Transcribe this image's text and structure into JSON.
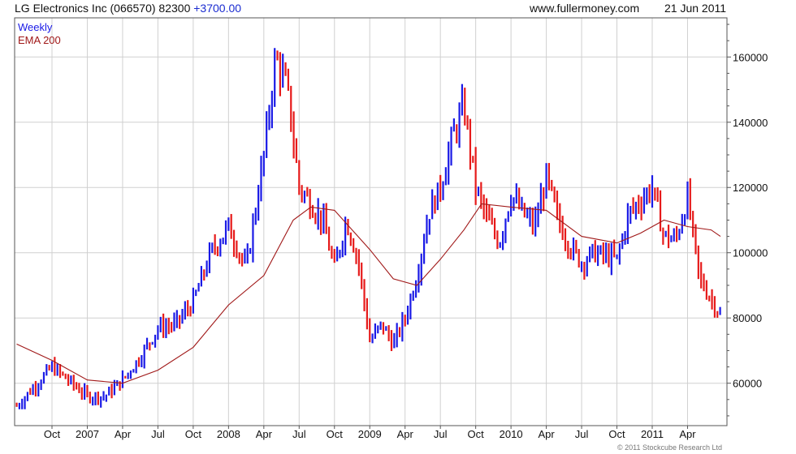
{
  "header": {
    "title": "LG Electronics Inc (066570) 82300",
    "change": "+3700.00",
    "site": "www.fullermoney.com",
    "date": "21 Jun 2011"
  },
  "copyright": "© 2011 Stockcube Research Ltd",
  "colors": {
    "up": "#1a1ae6",
    "down": "#e61a1a",
    "ema": "#a01818",
    "grid": "#d0d0d0",
    "frame": "#555555"
  },
  "chart_data": {
    "type": "line",
    "style": "weekly OHLC bars colored by direction with EMA overlay",
    "ylim": [
      47000,
      172000
    ],
    "yticks": [
      60000,
      80000,
      100000,
      120000,
      140000,
      160000
    ],
    "ytick_labels": [
      "60000",
      "80000",
      "100000",
      "120000",
      "140000",
      "160000"
    ],
    "xrange_months": [
      0,
      57.2
    ],
    "xticks": [
      {
        "label": "Oct",
        "m": 3
      },
      {
        "label": "2007",
        "m": 6
      },
      {
        "label": "Apr",
        "m": 9
      },
      {
        "label": "Jul",
        "m": 12
      },
      {
        "label": "Oct",
        "m": 15
      },
      {
        "label": "2008",
        "m": 18
      },
      {
        "label": "Apr",
        "m": 21
      },
      {
        "label": "Jul",
        "m": 24
      },
      {
        "label": "Oct",
        "m": 27
      },
      {
        "label": "2009",
        "m": 30
      },
      {
        "label": "Apr",
        "m": 33
      },
      {
        "label": "Jul",
        "m": 36
      },
      {
        "label": "Oct",
        "m": 39
      },
      {
        "label": "2010",
        "m": 42
      },
      {
        "label": "Apr",
        "m": 45
      },
      {
        "label": "Jul",
        "m": 48
      },
      {
        "label": "Oct",
        "m": 51
      },
      {
        "label": "2011",
        "m": 54
      },
      {
        "label": "Apr",
        "m": 57
      }
    ],
    "grid": true,
    "legend_position": "top-left",
    "series": [
      {
        "name": "Weekly",
        "x": [
          0,
          3,
          6,
          7.5,
          9,
          10.5,
          12,
          13.5,
          15,
          16.5,
          18,
          19.5,
          21,
          22,
          23,
          24,
          25,
          26,
          27,
          28,
          29,
          30,
          31,
          32,
          33,
          34,
          35,
          36,
          37,
          38,
          39,
          40,
          41,
          42,
          43,
          44,
          45,
          46,
          47,
          48,
          49,
          50,
          51,
          52,
          53,
          54,
          55,
          56,
          57,
          58,
          59.8
        ],
        "y": [
          53000,
          65000,
          56000,
          56000,
          61000,
          68000,
          77000,
          78000,
          85000,
          100000,
          108000,
          95000,
          130000,
          160000,
          150000,
          120000,
          115000,
          110000,
          95000,
          110000,
          98000,
          73000,
          78000,
          72000,
          80000,
          93000,
          112000,
          120000,
          135000,
          145000,
          120000,
          110000,
          103000,
          118000,
          112000,
          108000,
          123000,
          110000,
          102000,
          97000,
          100000,
          99000,
          98000,
          112000,
          116000,
          120000,
          105000,
          104000,
          117000,
          92000,
          81000
        ]
      },
      {
        "name": "EMA 200",
        "x": [
          0,
          3,
          6,
          9,
          12,
          15,
          18,
          21,
          23.5,
          25,
          27,
          30,
          32,
          34,
          36,
          38,
          39.5,
          42,
          45,
          48,
          51,
          53,
          55,
          56,
          57,
          59,
          59.8
        ],
        "y": [
          72000,
          67000,
          61000,
          60000,
          64000,
          71000,
          84000,
          93000,
          110000,
          114000,
          113000,
          101000,
          92000,
          90000,
          98000,
          107000,
          115000,
          114000,
          113000,
          105000,
          103000,
          106000,
          110000,
          109000,
          108000,
          107000,
          105000
        ]
      }
    ]
  }
}
